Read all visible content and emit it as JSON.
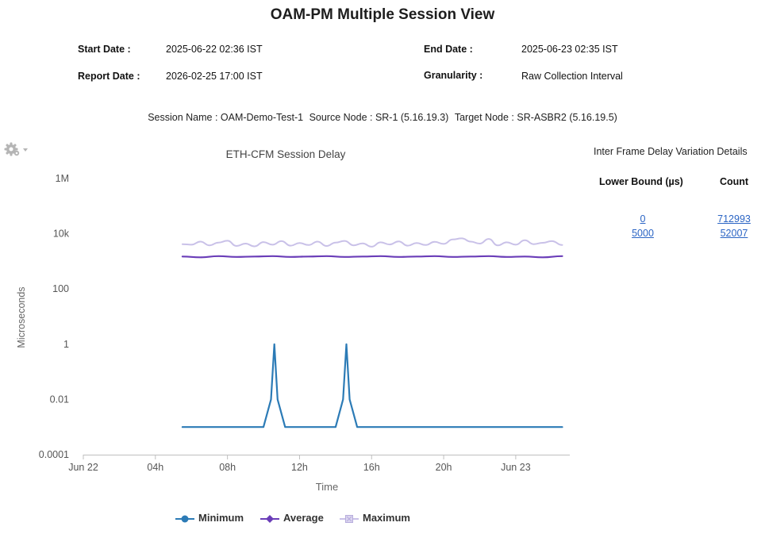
{
  "header": {
    "title": "OAM-PM Multiple Session View",
    "start_date_label": "Start Date :",
    "start_date_value": "2025-06-22 02:36 IST",
    "end_date_label": "End Date :",
    "end_date_value": "2025-06-23 02:35 IST",
    "report_date_label": "Report Date :",
    "report_date_value": "2026-02-25 17:00 IST",
    "granularity_label": "Granularity :",
    "granularity_value": "Raw Collection Interval"
  },
  "session": {
    "name": "Session Name : OAM-Demo-Test-1",
    "source": "Source Node : SR-1 (5.16.19.3)",
    "target": "Target Node : SR-ASBR2 (5.16.19.5)"
  },
  "icons": {
    "settings": "gear-icon",
    "dropdown": "caret-down-icon"
  },
  "chart_data": {
    "type": "line",
    "title": "ETH-CFM Session Delay",
    "xlabel": "Time",
    "ylabel": "Microseconds",
    "y_scale": "log",
    "ylim": [
      0.0001,
      1000000
    ],
    "y_ticks": [
      0.0001,
      0.01,
      1,
      100,
      10000,
      1000000
    ],
    "y_tick_labels": [
      "0.0001",
      "0.01",
      "1",
      "100",
      "10k",
      "1M"
    ],
    "xlim": [
      "2025-06-22 00:00",
      "2025-06-23 03:00"
    ],
    "x_ticks": [
      "2025-06-22 00:00",
      "2025-06-22 04:00",
      "2025-06-22 08:00",
      "2025-06-22 12:00",
      "2025-06-22 16:00",
      "2025-06-22 20:00",
      "2025-06-23 00:00"
    ],
    "x_tick_labels": [
      "Jun 22",
      "04h",
      "08h",
      "12h",
      "16h",
      "20h",
      "Jun 23"
    ],
    "grid": false,
    "legend_position": "bottom-center",
    "series": [
      {
        "name": "Minimum",
        "color": "#2c7bb6",
        "points": [
          [
            "2025-06-22 05:30",
            0.001
          ],
          [
            "2025-06-22 10:00",
            0.001
          ],
          [
            "2025-06-22 10:25",
            0.01
          ],
          [
            "2025-06-22 10:36",
            1
          ],
          [
            "2025-06-22 10:47",
            0.01
          ],
          [
            "2025-06-22 11:12",
            0.001
          ],
          [
            "2025-06-22 14:00",
            0.001
          ],
          [
            "2025-06-22 14:25",
            0.01
          ],
          [
            "2025-06-22 14:36",
            1
          ],
          [
            "2025-06-22 14:47",
            0.01
          ],
          [
            "2025-06-22 15:12",
            0.001
          ],
          [
            "2025-06-23 02:35",
            0.001
          ]
        ]
      },
      {
        "name": "Average",
        "color": "#6a3db8",
        "points": [
          [
            "2025-06-22 05:30",
            1500
          ],
          [
            "2025-06-22 06:30",
            1400
          ],
          [
            "2025-06-22 07:30",
            1550
          ],
          [
            "2025-06-22 08:30",
            1450
          ],
          [
            "2025-06-22 09:30",
            1500
          ],
          [
            "2025-06-22 10:30",
            1550
          ],
          [
            "2025-06-22 11:30",
            1450
          ],
          [
            "2025-06-22 12:30",
            1500
          ],
          [
            "2025-06-22 13:30",
            1550
          ],
          [
            "2025-06-22 14:30",
            1450
          ],
          [
            "2025-06-22 15:30",
            1500
          ],
          [
            "2025-06-22 16:30",
            1550
          ],
          [
            "2025-06-22 17:30",
            1450
          ],
          [
            "2025-06-22 18:30",
            1500
          ],
          [
            "2025-06-22 19:30",
            1550
          ],
          [
            "2025-06-22 20:30",
            1450
          ],
          [
            "2025-06-22 21:30",
            1500
          ],
          [
            "2025-06-22 22:30",
            1550
          ],
          [
            "2025-06-22 23:30",
            1450
          ],
          [
            "2025-06-23 00:30",
            1500
          ],
          [
            "2025-06-23 01:30",
            1400
          ],
          [
            "2025-06-23 02:35",
            1550
          ]
        ]
      },
      {
        "name": "Maximum",
        "color": "#c9c1e8",
        "points": [
          [
            "2025-06-22 05:30",
            4200
          ],
          [
            "2025-06-22 06:00",
            4000
          ],
          [
            "2025-06-22 06:30",
            5200
          ],
          [
            "2025-06-22 07:00",
            3800
          ],
          [
            "2025-06-22 07:30",
            4800
          ],
          [
            "2025-06-22 08:00",
            5600
          ],
          [
            "2025-06-22 08:30",
            3600
          ],
          [
            "2025-06-22 09:00",
            4400
          ],
          [
            "2025-06-22 09:30",
            3500
          ],
          [
            "2025-06-22 10:00",
            5000
          ],
          [
            "2025-06-22 10:30",
            4000
          ],
          [
            "2025-06-22 11:00",
            5400
          ],
          [
            "2025-06-22 11:30",
            3700
          ],
          [
            "2025-06-22 12:00",
            4600
          ],
          [
            "2025-06-22 12:30",
            3900
          ],
          [
            "2025-06-22 13:00",
            5200
          ],
          [
            "2025-06-22 13:30",
            3600
          ],
          [
            "2025-06-22 14:00",
            4800
          ],
          [
            "2025-06-22 14:30",
            5500
          ],
          [
            "2025-06-22 15:00",
            3800
          ],
          [
            "2025-06-22 15:30",
            4500
          ],
          [
            "2025-06-22 16:00",
            3400
          ],
          [
            "2025-06-22 16:30",
            4900
          ],
          [
            "2025-06-22 17:00",
            4100
          ],
          [
            "2025-06-22 17:30",
            5300
          ],
          [
            "2025-06-22 18:00",
            3700
          ],
          [
            "2025-06-22 18:30",
            4600
          ],
          [
            "2025-06-22 19:00",
            3900
          ],
          [
            "2025-06-22 19:30",
            5100
          ],
          [
            "2025-06-22 20:00",
            4300
          ],
          [
            "2025-06-22 20:30",
            6200
          ],
          [
            "2025-06-22 21:00",
            6800
          ],
          [
            "2025-06-22 21:30",
            5200
          ],
          [
            "2025-06-22 22:00",
            4400
          ],
          [
            "2025-06-22 22:30",
            6500
          ],
          [
            "2025-06-22 23:00",
            3800
          ],
          [
            "2025-06-22 23:30",
            4900
          ],
          [
            "2025-06-23 00:00",
            4000
          ],
          [
            "2025-06-23 00:30",
            5800
          ],
          [
            "2025-06-23 01:00",
            4200
          ],
          [
            "2025-06-23 01:30",
            4700
          ],
          [
            "2025-06-23 02:00",
            5400
          ],
          [
            "2025-06-23 02:35",
            3900
          ]
        ]
      }
    ]
  },
  "ifdv": {
    "title": "Inter Frame Delay Variation Details",
    "col_lower_bound": "Lower Bound (µs)",
    "col_count": "Count",
    "rows": [
      {
        "lower_bound": "0",
        "count": "712993"
      },
      {
        "lower_bound": "5000",
        "count": "52007"
      }
    ]
  },
  "legend": {
    "minimum": "Minimum",
    "average": "Average",
    "maximum": "Maximum"
  }
}
